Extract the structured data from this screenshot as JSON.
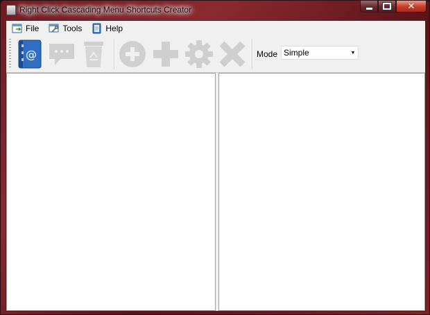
{
  "window": {
    "title": "Right Click Cascading Menu Shortcuts Creator",
    "controls": {
      "minimize": "minimize-icon",
      "maximize": "maximize-icon",
      "close": "close-icon"
    }
  },
  "menubar": {
    "items": [
      {
        "label": "File",
        "icon": "file-menu-icon"
      },
      {
        "label": "Tools",
        "icon": "tools-menu-icon"
      },
      {
        "label": "Help",
        "icon": "help-menu-icon"
      }
    ]
  },
  "toolbar": {
    "buttons": [
      {
        "icon": "address-book-icon",
        "enabled": true
      },
      {
        "icon": "speech-bubble-icon",
        "enabled": false
      },
      {
        "icon": "recycle-bin-icon",
        "enabled": false
      },
      {
        "icon": "add-circle-icon",
        "enabled": false
      },
      {
        "icon": "plus-icon",
        "enabled": false
      },
      {
        "icon": "gear-icon",
        "enabled": false
      },
      {
        "icon": "delete-x-icon",
        "enabled": false
      }
    ],
    "mode": {
      "label": "Mode",
      "value": "Simple"
    }
  },
  "colors": {
    "frame": "#7a2228",
    "client": "#f0f0f0",
    "disabled_icon": "#c8c8c8",
    "address_book_blue": "#2e6fc4"
  }
}
